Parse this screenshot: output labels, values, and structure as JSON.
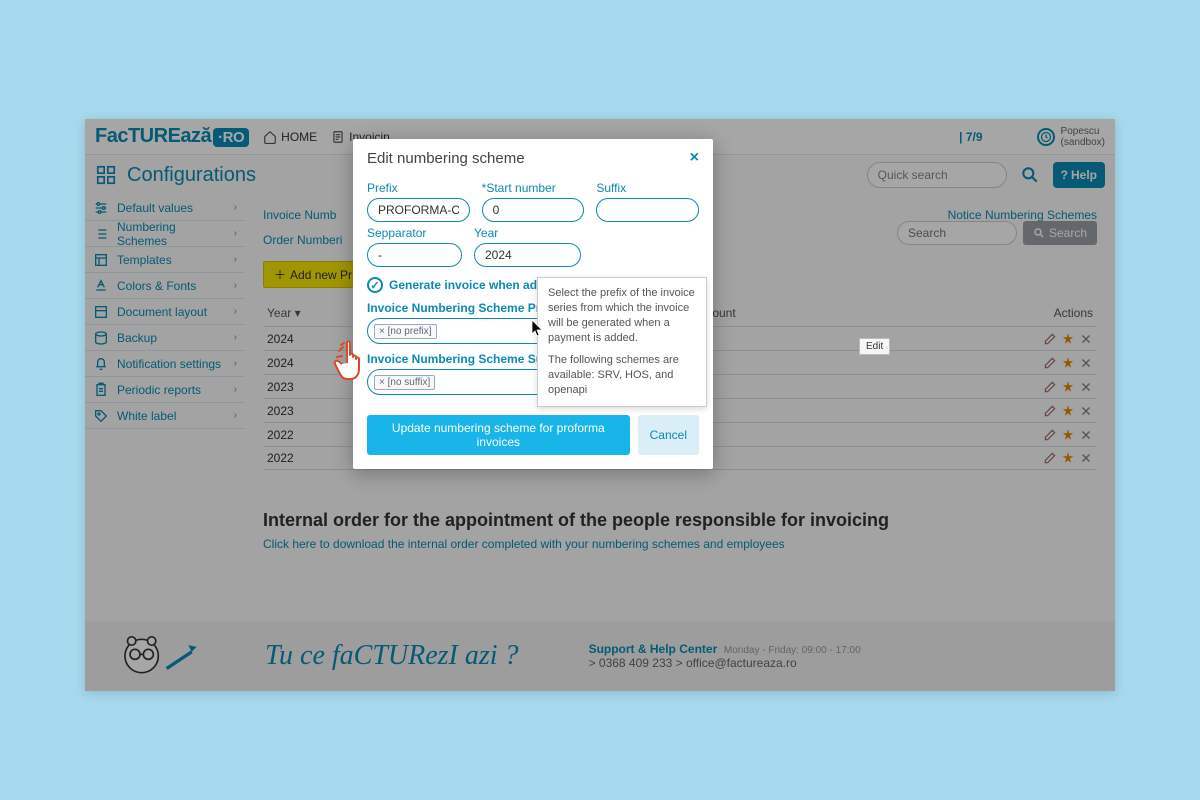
{
  "logo": {
    "text": "FacTUREază",
    "badge": "·RO"
  },
  "nav": {
    "home": "HOME",
    "invoicing": "Invoicin"
  },
  "counter": "7/9",
  "user": {
    "name": "Popescu",
    "env": "(sandbox)"
  },
  "config": {
    "title": "Configurations",
    "quicksearch_placeholder": "Quick search",
    "help": "Help"
  },
  "sidebar": {
    "items": [
      {
        "label": "Default values"
      },
      {
        "label": "Numbering Schemes"
      },
      {
        "label": "Templates"
      },
      {
        "label": "Colors & Fonts"
      },
      {
        "label": "Document layout"
      },
      {
        "label": "Backup"
      },
      {
        "label": "Notification settings"
      },
      {
        "label": "Periodic reports"
      },
      {
        "label": "White label"
      }
    ]
  },
  "tabs": {
    "invoice": "Invoice Numb",
    "notice": "Notice Numbering Schemes",
    "order": "Order Numberi"
  },
  "table": {
    "add_button": "Add new Pr",
    "search_placeholder": "Search",
    "search_button": "Search",
    "head_year": "Year",
    "head_mid": "roforma Invoices count",
    "head_actions": "Actions",
    "rows": [
      {
        "year": "2024"
      },
      {
        "year": "2024"
      },
      {
        "year": "2023"
      },
      {
        "year": "2023"
      },
      {
        "year": "2022"
      },
      {
        "year": "2022"
      }
    ]
  },
  "section": {
    "title": "Internal order for the appointment of the people responsible for invoicing",
    "link": "Click here to download the internal order completed with your numbering schemes and employees"
  },
  "footer": {
    "slogan": "Tu ce faCTURezI azi ?",
    "support_title": "Support & Help Center",
    "hours": "Monday - Friday: 09:00 - 17:00",
    "phone": "> 0368 409 233 > office@factureaza.ro"
  },
  "modal": {
    "title": "Edit numbering scheme",
    "prefix_label": "Prefix",
    "prefix_value": "PROFORMA-OA",
    "start_label": "*Start number",
    "start_value": "0",
    "suffix_label": "Suffix",
    "suffix_value": "",
    "separator_label": "Sepparator",
    "separator_value": "-",
    "year_label": "Year",
    "year_value": "2024",
    "checkbox_label": "Generate invoice when adding a pa",
    "scheme_prefix_label": "Invoice Numbering Scheme Prefix",
    "scheme_prefix_tag": "× [no prefix]",
    "scheme_suffix_label": "Invoice Numbering Scheme Suffix",
    "scheme_suffix_tag": "× [no suffix]",
    "update_button": "Update numbering scheme for proforma invoices",
    "cancel_button": "Cancel"
  },
  "tooltip": {
    "p1": "Select the prefix of the invoice series from which the invoice will be generated when a payment is added.",
    "p2": "The following schemes are available: SRV, HOS, and openapi"
  },
  "edit_tooltip": "Edit"
}
